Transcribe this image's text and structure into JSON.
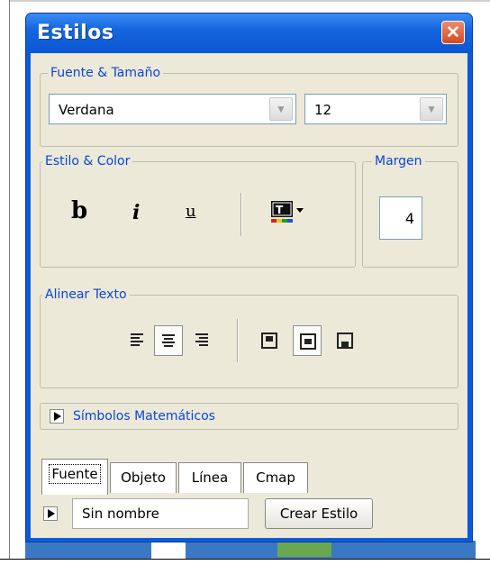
{
  "window": {
    "title": "Estilos"
  },
  "font_group": {
    "legend": "Fuente & Tamaño",
    "font_value": "Verdana",
    "size_value": "12"
  },
  "style_group": {
    "legend": "Estilo & Color",
    "bold_glyph": "b",
    "italic_glyph": "i",
    "underline_glyph": "u",
    "color_icon": "text-color-icon"
  },
  "margin_group": {
    "legend": "Margen",
    "value": "4"
  },
  "align_group": {
    "legend": "Alinear Texto",
    "selected_text_align": "center",
    "selected_box_align": "center"
  },
  "math_section": {
    "label": "Símbolos Matemáticos"
  },
  "tabs": [
    {
      "label": "Fuente",
      "active": true
    },
    {
      "label": "Objeto",
      "active": false
    },
    {
      "label": "Línea",
      "active": false
    },
    {
      "label": "Cmap",
      "active": false
    }
  ],
  "footer": {
    "style_name": "Sin nombre",
    "create_button": "Crear Estilo"
  },
  "colors": {
    "titlebar": "#0b56d2",
    "accent_text": "#0a46d8",
    "close": "#d24a24",
    "client": "#ece9d8"
  }
}
